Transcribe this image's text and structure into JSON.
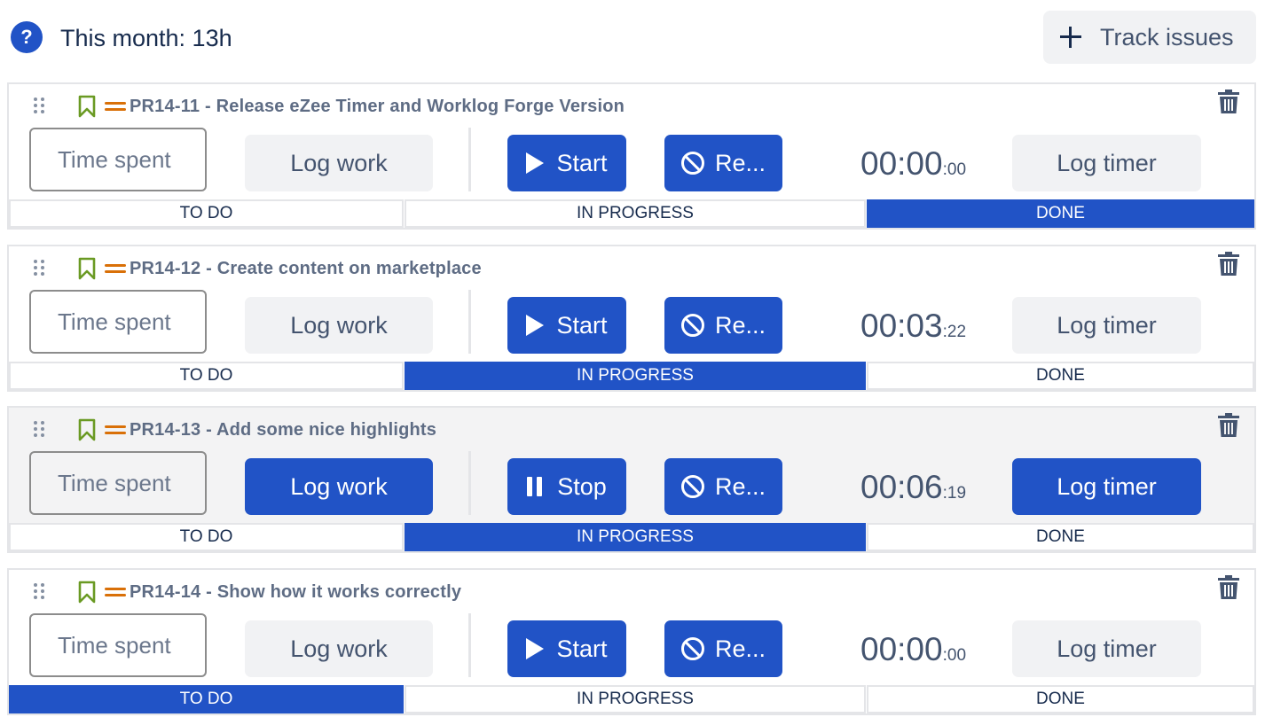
{
  "header": {
    "help_icon": "question-circle-icon",
    "help_glyph": "?",
    "month_label": "This month: 13h",
    "track_button_label": "Track issues",
    "track_button_icon": "plus-icon"
  },
  "colors": {
    "accent": "#2153c6",
    "bookmark": "#6a9a23",
    "priority": "#d97008"
  },
  "issues": [
    {
      "title": "PR14-11 - Release eZee Timer and Worklog Forge Version",
      "time_placeholder": "Time spent",
      "log_work_label": "Log work",
      "timer_action_label": "Start",
      "timer_action_icon": "play-icon",
      "reset_label": "Re...",
      "timer_main": "00:00",
      "timer_seconds": ":00",
      "log_timer_label": "Log timer",
      "statuses": [
        "TO DO",
        "IN PROGRESS",
        "DONE"
      ],
      "active_status": "DONE"
    },
    {
      "title": "PR14-12 - Create content on marketplace",
      "time_placeholder": "Time spent",
      "log_work_label": "Log work",
      "timer_action_label": "Start",
      "timer_action_icon": "play-icon",
      "reset_label": "Re...",
      "timer_main": "00:03",
      "timer_seconds": ":22",
      "log_timer_label": "Log timer",
      "statuses": [
        "TO DO",
        "IN PROGRESS",
        "DONE"
      ],
      "active_status": "IN PROGRESS"
    },
    {
      "title": "PR14-13 - Add some nice highlights",
      "time_placeholder": "Time spent",
      "log_work_label": "Log work",
      "timer_action_label": "Stop",
      "timer_action_icon": "pause-icon",
      "reset_label": "Re...",
      "timer_main": "00:06",
      "timer_seconds": ":19",
      "log_timer_label": "Log timer",
      "statuses": [
        "TO DO",
        "IN PROGRESS",
        "DONE"
      ],
      "active_status": "IN PROGRESS"
    },
    {
      "title": "PR14-14 - Show how it works correctly",
      "time_placeholder": "Time spent",
      "log_work_label": "Log work",
      "timer_action_label": "Start",
      "timer_action_icon": "play-icon",
      "reset_label": "Re...",
      "timer_main": "00:00",
      "timer_seconds": ":00",
      "log_timer_label": "Log timer",
      "statuses": [
        "TO DO",
        "IN PROGRESS",
        "DONE"
      ],
      "active_status": "TO DO"
    }
  ]
}
